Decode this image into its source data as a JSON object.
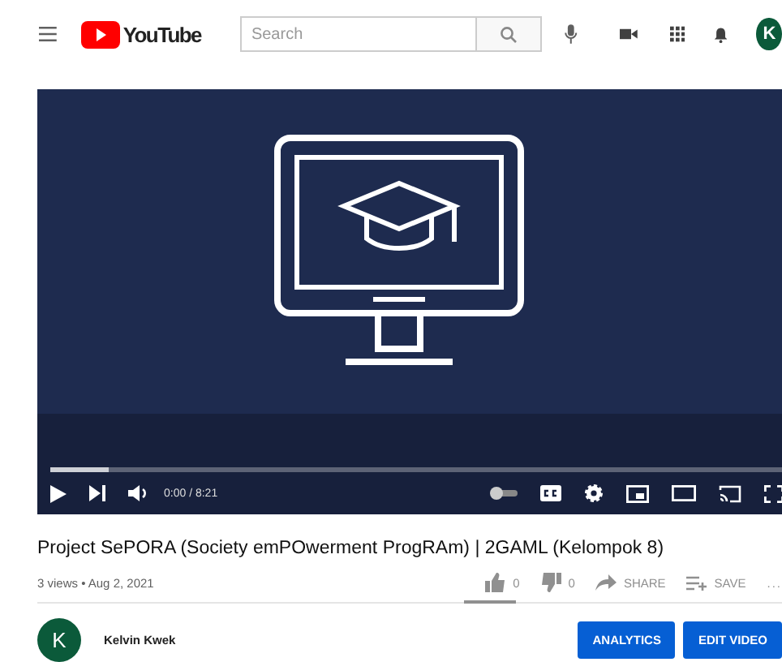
{
  "header": {
    "logo_text": "YouTube",
    "search": {
      "placeholder": "Search"
    },
    "avatar_letter": "K"
  },
  "player": {
    "progress": {
      "level": 0.08
    },
    "time": "0:00 / 8:21"
  },
  "video": {
    "title": "Project SePORA (Society emPOwerment ProgRAm) | 2GAML (Kelompok 8)",
    "meta": "3 views • Aug 2, 2021",
    "actions": [
      {
        "kind": "like",
        "label": "0"
      },
      {
        "kind": "dislike",
        "label": "0"
      },
      {
        "kind": "share",
        "label": "SHARE"
      },
      {
        "kind": "save",
        "label": "SAVE"
      },
      {
        "kind": "more",
        "label": "..."
      }
    ]
  },
  "channel": {
    "avatar_letter": "K",
    "name": "Kelvin Kwek",
    "buttons": [
      "ANALYTICS",
      "EDIT VIDEO"
    ]
  }
}
